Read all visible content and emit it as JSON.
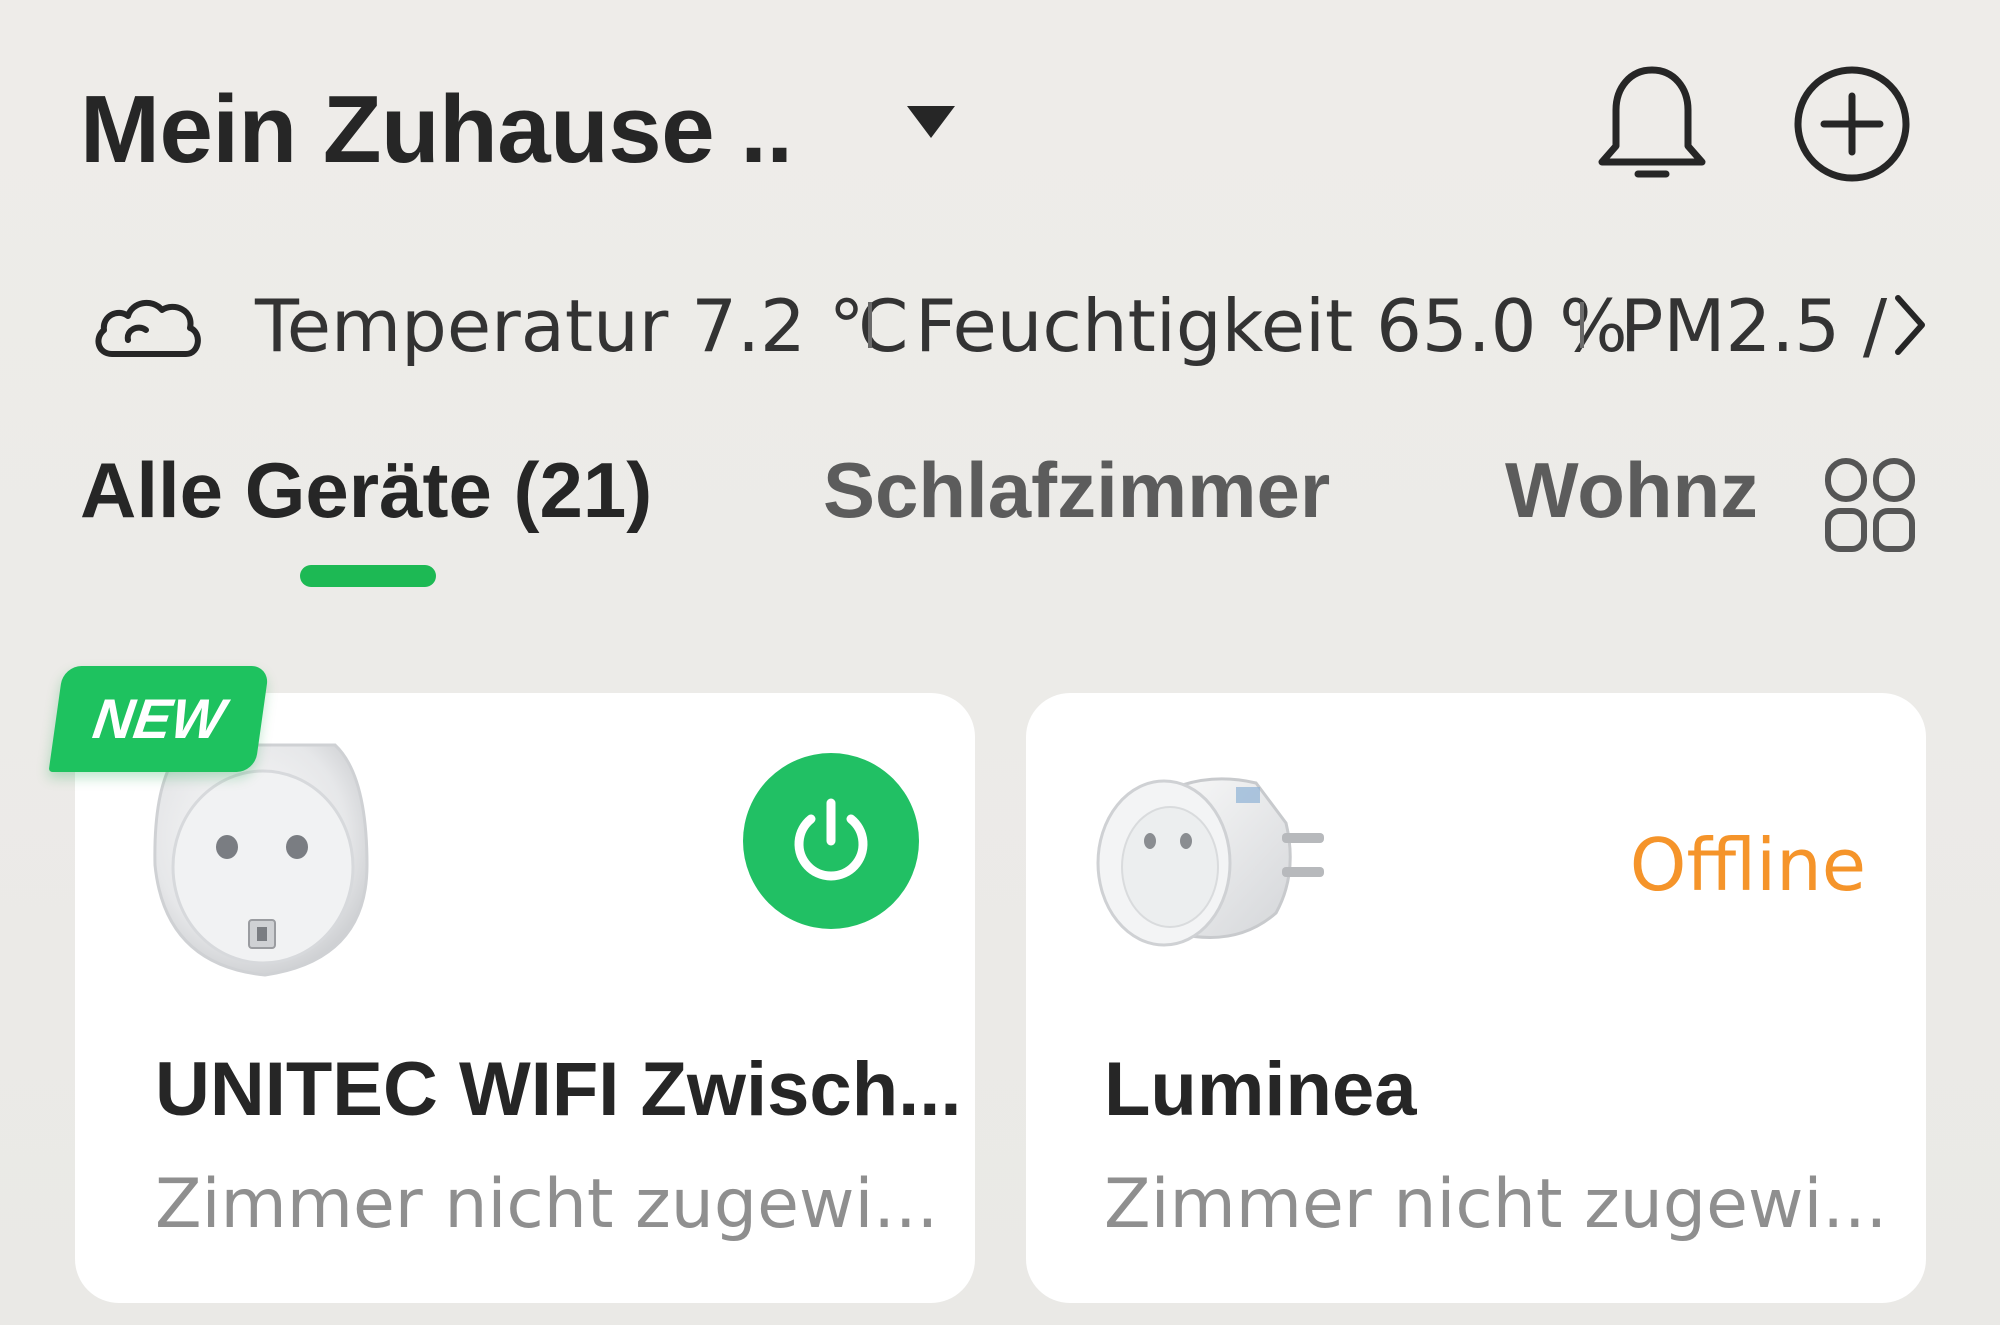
{
  "header": {
    "home_title": "Mein Zuhause ..",
    "icons": [
      "caret-down-icon",
      "bell-icon",
      "plus-circle-icon"
    ]
  },
  "weather": {
    "icon": "cloud-icon",
    "temperature": "Temperatur 7.2 ℃",
    "humidity": "Feuchtigkeit 65.0 %",
    "pm25": "PM2.5 /"
  },
  "tabs": {
    "all": "Alle Geräte (21)",
    "bedroom": "Schlafzimmer",
    "living": "Wohnz",
    "grid_icon": "grid-icon",
    "accent_color": "#1db954"
  },
  "devices": [
    {
      "badge": "NEW",
      "name": "UNITEC WIFI Zwisch...",
      "room": "Zimmer nicht zugewi...",
      "control_icon": "power-icon",
      "control_color": "#21c064"
    },
    {
      "name": "Luminea",
      "room": "Zimmer nicht zugewi...",
      "status": "Offline",
      "status_color": "#f5942a"
    }
  ]
}
